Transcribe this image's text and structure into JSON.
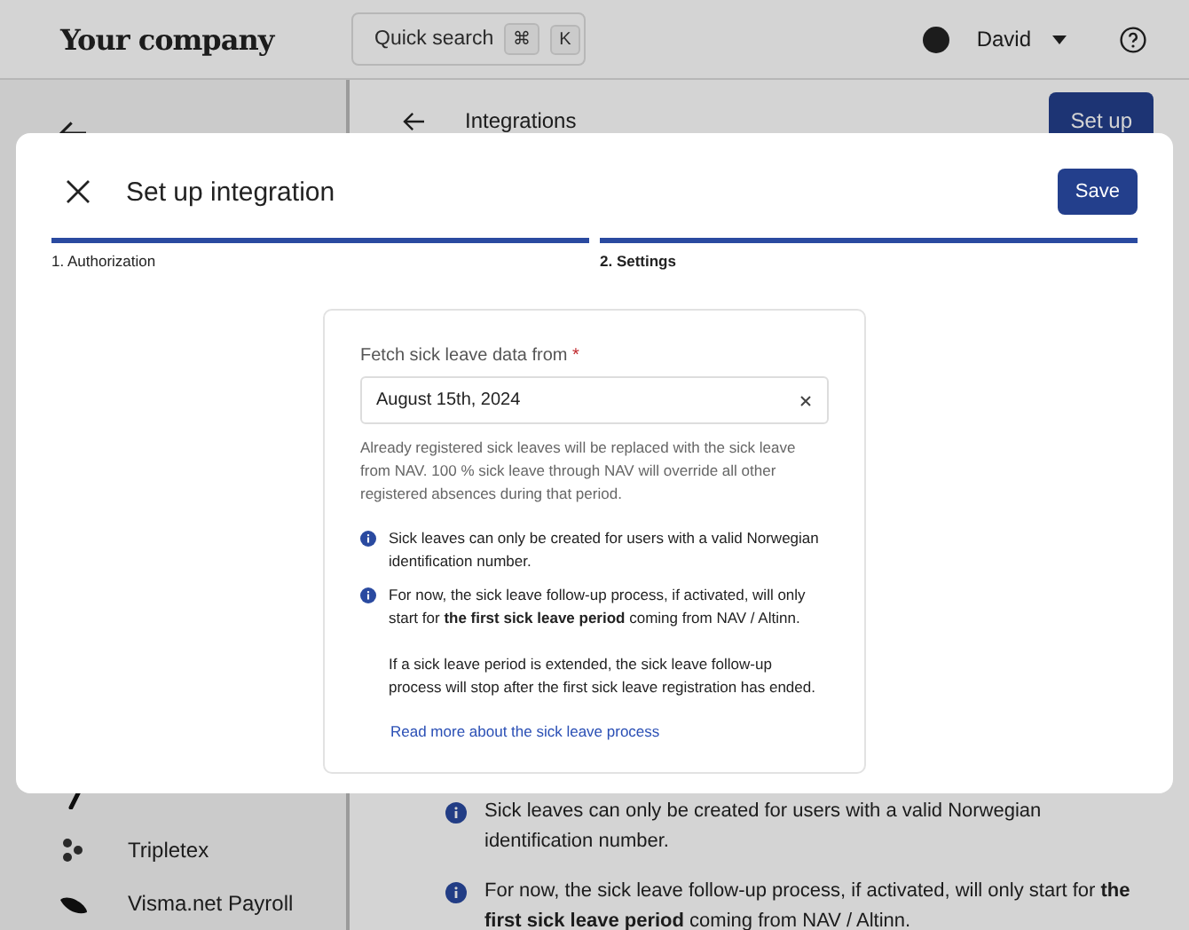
{
  "header": {
    "logo": "Your company",
    "search": {
      "placeholder": "Quick search",
      "keys": [
        "⌘",
        "K"
      ]
    },
    "user": {
      "name": "David"
    }
  },
  "sidebar": {
    "items": [
      {
        "kind": "slash"
      },
      {
        "label": "Tripletex",
        "kind": "dots"
      },
      {
        "label": "Visma.net Payroll",
        "kind": "leaf"
      }
    ]
  },
  "content": {
    "title": "Integrations",
    "button": "Set up",
    "notes": [
      {
        "text": "Sick leaves can only be created for users with a valid Norwegian identification number."
      },
      {
        "text": "For now, the sick leave follow-up process, if activated, will only start for **the first sick leave period** coming from NAV / Altinn."
      }
    ]
  },
  "dialog": {
    "title": "Set up integration",
    "save": "Save",
    "steps": [
      {
        "label": "1. Authorization",
        "selected": false
      },
      {
        "label": "2. Settings",
        "selected": true
      }
    ],
    "field": {
      "label": "Fetch sick leave data from",
      "required": true,
      "required_mark": "*",
      "value": "August 15th, 2024"
    },
    "help": "Already registered sick leaves will be replaced with the sick leave from NAV. 100 % sick leave through NAV will override all other registered absences during that period.",
    "notes": [
      {
        "paragraphs": [
          "Sick leaves can only be created for users with a valid Norwegian identification number."
        ]
      },
      {
        "paragraphs": [
          "For now, the sick leave follow-up process, if activated, will only start for **the first sick leave period** coming from NAV / Altinn.",
          "If a sick leave period is extended, the sick leave follow-up process will stop after the first sick leave registration has ended."
        ]
      }
    ],
    "link": "Read more about the sick leave process"
  }
}
